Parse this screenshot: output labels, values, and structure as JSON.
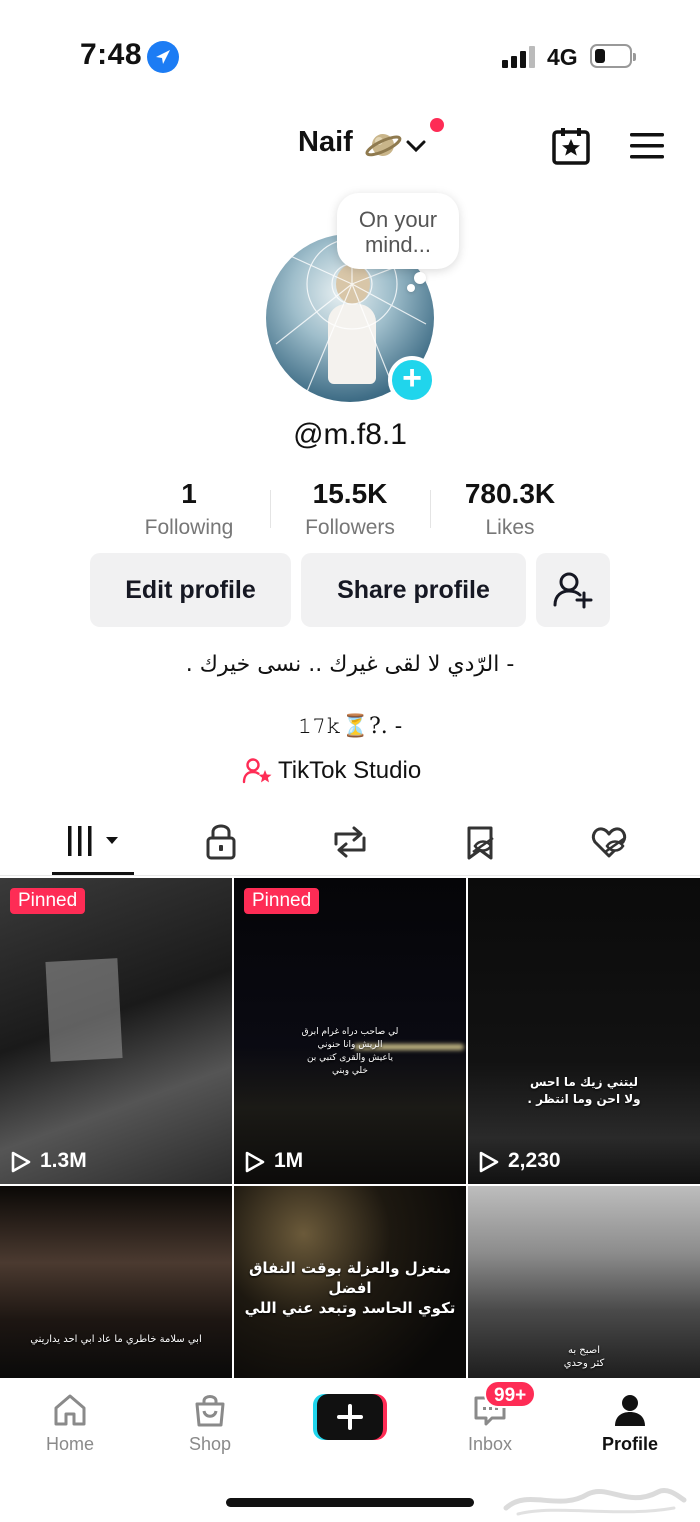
{
  "status_bar": {
    "time": "7:48",
    "network": "4G"
  },
  "header": {
    "name": "Naif"
  },
  "avatar_bubble": {
    "line1": "On your",
    "line2": "mind..."
  },
  "profile": {
    "username": "@m.f8.1",
    "stats": [
      {
        "value": "1",
        "label": "Following"
      },
      {
        "value": "15.5K",
        "label": "Followers"
      },
      {
        "value": "780.3K",
        "label": "Likes"
      }
    ],
    "buttons": {
      "edit": "Edit profile",
      "share": "Share profile"
    },
    "bio_line1": "- الرّدي لا لقى غيرك .. نسى خيرك .",
    "bio_line2": "𝟷𝟽𝚔⏳?. -",
    "studio_link": "TikTok Studio"
  },
  "tabs": [
    {
      "icon": "grid-icon"
    },
    {
      "icon": "lock-icon"
    },
    {
      "icon": "repost-icon"
    },
    {
      "icon": "saved-icon"
    },
    {
      "icon": "liked-icon"
    }
  ],
  "videos": [
    {
      "pinned": "Pinned",
      "views": "1.3M"
    },
    {
      "pinned": "Pinned",
      "views": "1M",
      "caption": "لي صاحب دراه غرام ابرق\nالريش وانا حنوني\nياعيش والقرى كتبي بن\nخلي وبني"
    },
    {
      "views": "2,230",
      "caption": "ليتني زيك ما احس\nولا احن وما انتظر ."
    },
    {
      "caption": "ابي سلامة خاطري ما عاد ابي احد يداريني"
    },
    {
      "caption": "منعزل والعزلة بوقت النفاق افضل\nتكوي الحاسد وتبعد عني اللي"
    },
    {
      "caption": "اصبح به\nكثر وحدي"
    }
  ],
  "bottom_nav": {
    "items": [
      {
        "label": "Home",
        "icon": "home-icon"
      },
      {
        "label": "Shop",
        "icon": "shop-icon"
      },
      {
        "label": "Inbox",
        "icon": "inbox-icon"
      },
      {
        "label": "Profile",
        "icon": "profile-icon"
      }
    ],
    "inbox_badge": "99+"
  },
  "colors": {
    "accent": "#fe2c55",
    "cyan": "#20d5ec",
    "button_bg": "#f1f1f2",
    "location_blue": "#1c7cf4"
  }
}
